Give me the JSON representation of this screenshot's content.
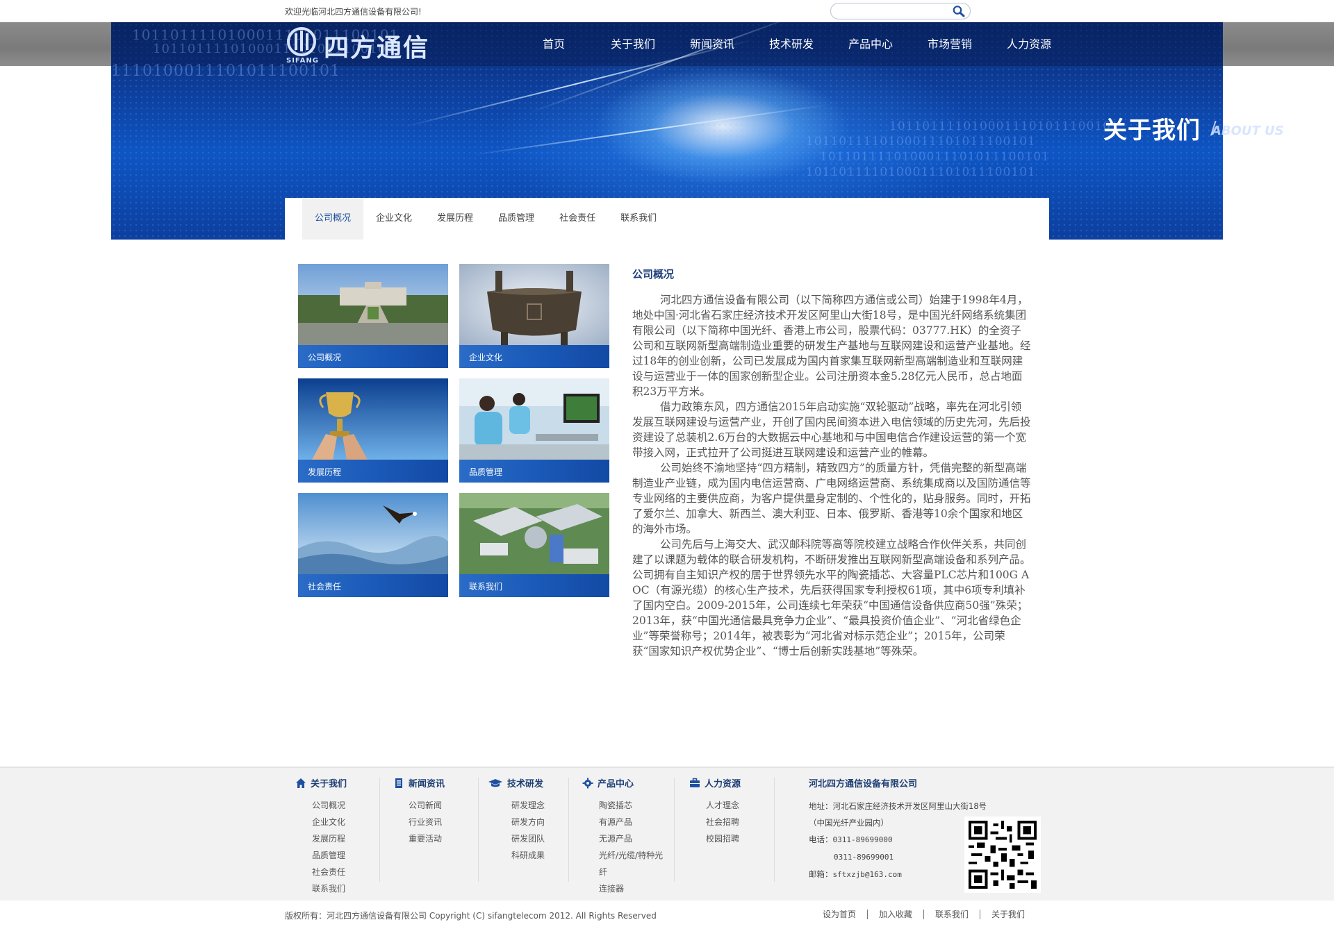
{
  "top": {
    "welcome": "欢迎光临河北四方通信设备有限公司!",
    "search_placeholder": ""
  },
  "brand": {
    "name": "四方通信",
    "en": "SIFANG"
  },
  "nav": [
    "首页",
    "关于我们",
    "新闻资讯",
    "技术研发",
    "产品中心",
    "市场营销",
    "人力资源"
  ],
  "banner": {
    "title": "关于我们",
    "slash": "/",
    "subtitle": "ABOUT US",
    "binary": [
      "1011011110100011101011100101",
      "1011011110100011101011100101",
      "1110100011101011100101"
    ]
  },
  "subnav": [
    "公司概况",
    "企业文化",
    "发展历程",
    "品质管理",
    "社会责任",
    "联系我们"
  ],
  "tiles": [
    "公司概况",
    "企业文化",
    "发展历程",
    "品质管理",
    "社会责任",
    "联系我们"
  ],
  "article": {
    "title": "公司概况",
    "paragraphs": [
      "河北四方通信设备有限公司（以下简称四方通信或公司）始建于1998年4月，地处中国·河北省石家庄经济技术开发区阿里山大街18号，是中国光纤网络系统集团有限公司（以下简称中国光纤、香港上市公司，股票代码：03777.HK）的全资子公司和互联网新型高端制造业重要的研发生产基地与互联网建设和运营产业基地。经过18年的创业创新，公司已发展成为国内首家集互联网新型高端制造业和互联网建设与运营业于一体的国家创新型企业。公司注册资本金5.28亿元人民币，总占地面积23万平方米。",
      "借力政策东风，四方通信2015年启动实施“双轮驱动”战略，率先在河北引领发展互联网建设与运营产业，开创了国内民间资本进入电信领域的历史先河，先后投资建设了总装机2.6万台的大数据云中心基地和与中国电信合作建设运营的第一个宽带接入网，正式拉开了公司挺进互联网建设和运营产业的帷幕。",
      "公司始终不渝地坚持“四方精制，精致四方”的质量方针，凭借完整的新型高端制造业产业链，成为国内电信运营商、广电网络运营商、系统集成商以及国防通信等专业网络的主要供应商，为客户提供量身定制的、个性化的，贴身服务。同时，开拓了爱尔兰、加拿大、新西兰、澳大利亚、日本、俄罗斯、香港等10余个国家和地区的海外市场。",
      "公司先后与上海交大、武汉邮科院等高等院校建立战略合作伙伴关系，共同创建了以课题为载体的联合研发机构，不断研发推出互联网新型高端设备和系列产品。公司拥有自主知识产权的居于世界领先水平的陶瓷插芯、大容量PLC芯片和100G AOC（有源光缆）的核心生产技术，先后获得国家专利授权61项，其中6项专利填补了国内空白。2009-2015年，公司连续七年荣获“中国通信设备供应商50强”殊荣；2013年，获“中国光通信最具竞争力企业”、“最具投资价值企业”、“河北省绿色企业”等荣誉称号；2014年，被表彰为“河北省对标示范企业”；2015年，公司荣获“国家知识产权优势企业”、“博士后创新实践基地”等殊荣。"
    ]
  },
  "footer": {
    "columns": [
      {
        "title": "关于我们",
        "icon": "home-icon",
        "items": [
          "公司概况",
          "企业文化",
          "发展历程",
          "品质管理",
          "社会责任",
          "联系我们"
        ]
      },
      {
        "title": "新闻资讯",
        "icon": "document-icon",
        "items": [
          "公司新闻",
          "行业资讯",
          "重要活动"
        ]
      },
      {
        "title": "技术研发",
        "icon": "graduation-cap-icon",
        "items": [
          "研发理念",
          "研发方向",
          "研发团队",
          "科研成果"
        ]
      },
      {
        "title": "产品中心",
        "icon": "gear-icon",
        "items": [
          "陶瓷插芯",
          "有源产品",
          "无源产品",
          "光纤/光缆/特种光",
          "纤",
          "连接器"
        ]
      },
      {
        "title": "人力资源",
        "icon": "briefcase-icon",
        "items": [
          "人才理念",
          "社会招聘",
          "校园招聘"
        ]
      }
    ],
    "company": {
      "name": "河北四方通信设备有限公司",
      "address": "地址：河北石家庄经济技术开发区阿里山大街18号",
      "address2": "（中国光纤产业园内）",
      "phone_label": "电话：",
      "phone1": "0311-89699000",
      "phone2": "0311-89699001",
      "email_label": "邮箱：",
      "email": "sftxzjb@163.com"
    },
    "copyright": "版权所有：河北四方通信设备有限公司 Copyright (C) sifangtelecom 2012. All Rights Reserved",
    "links": [
      "设为首页",
      "加入收藏",
      "联系我们",
      "关于我们"
    ]
  },
  "colors": {
    "brand_blue": "#1a4e9e",
    "banner_blue": "#0e55c4",
    "footer_bg": "#f2f2f2"
  }
}
